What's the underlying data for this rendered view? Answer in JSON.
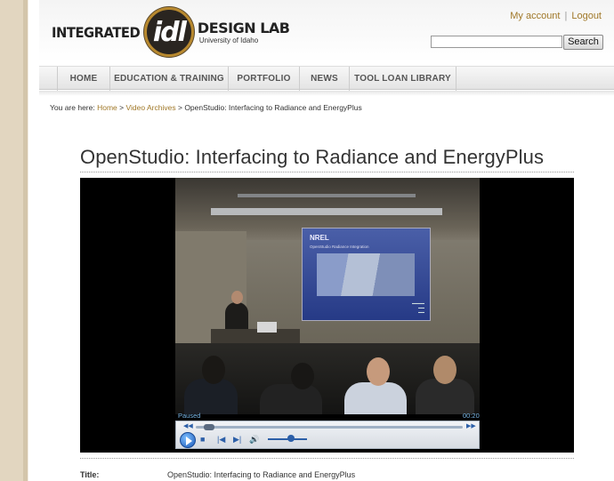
{
  "header": {
    "logo": {
      "left": "INTEGRATED",
      "mark": "idl",
      "right": "DESIGN LAB",
      "tagline": "University of Idaho"
    },
    "account_links": {
      "my_account": "My account",
      "separator": "|",
      "logout": "Logout"
    },
    "search": {
      "placeholder": "",
      "button_label": "Search"
    }
  },
  "nav": {
    "items": [
      {
        "label": "HOME"
      },
      {
        "label": "EDUCATION & TRAINING"
      },
      {
        "label": "PORTFOLIO"
      },
      {
        "label": "NEWS"
      },
      {
        "label": "TOOL LOAN LIBRARY"
      }
    ]
  },
  "breadcrumb": {
    "prefix": "You are here:",
    "items": [
      "Home",
      "Video Archives"
    ],
    "separator": ">",
    "current": "OpenStudio: Interfacing to Radiance and EnergyPlus"
  },
  "page_title": "OpenStudio: Interfacing to Radiance and EnergyPlus",
  "player": {
    "slide_logo": "NREL",
    "slide_heading": "OpenStudio Radiance Integration",
    "state": "Paused",
    "time": "00:20",
    "seek_position": 0.03,
    "volume_level": 0.6
  },
  "meta": {
    "title_label": "Title:",
    "title_value": "OpenStudio: Interfacing to Radiance and EnergyPlus"
  },
  "colors": {
    "link": "#a07828",
    "accent_logo_ring": "#b8892f",
    "player_status": "#7ab8e8"
  },
  "icons": {
    "play": "play-icon",
    "stop": "stop-icon",
    "previous": "previous-icon",
    "next": "next-icon",
    "volume": "volume-icon",
    "rewind": "rewind-icon",
    "fast_forward": "fast-forward-icon"
  }
}
